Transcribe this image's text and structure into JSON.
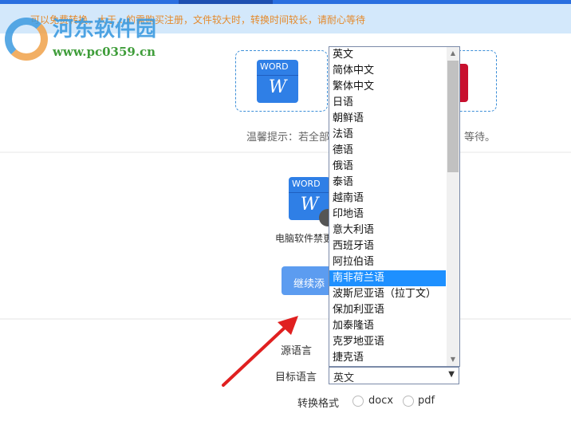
{
  "banner": {
    "text": "可以免费转换，大于…的需购买注册，文件较大时，转换时间较长，请耐心等待"
  },
  "watermark": {
    "title": "河东软件园",
    "url": "www.pc0359.cn"
  },
  "icons": {
    "word_label": "WORD",
    "word_letter": "W"
  },
  "hint": {
    "start": "温馨提示：若全部",
    "end": "等待。"
  },
  "file": {
    "name": "电脑软件禁更"
  },
  "buttons": {
    "add_more": "继续添"
  },
  "form": {
    "source_label": "源语言",
    "target_label": "目标语言",
    "target_value": "英文",
    "format_label": "转换格式",
    "formats": [
      "docx",
      "pdf"
    ]
  },
  "dropdown": {
    "items": [
      "英文",
      "简体中文",
      "繁体中文",
      "日语",
      "朝鲜语",
      "法语",
      "德语",
      "俄语",
      "泰语",
      "越南语",
      "印地语",
      "意大利语",
      "西班牙语",
      "阿拉伯语",
      "南非荷兰语",
      "波斯尼亚语（拉丁文）",
      "保加利亚语",
      "加泰隆语",
      "克罗地亚语",
      "捷克语"
    ],
    "highlighted": "南非荷兰语"
  },
  "colors": {
    "accent": "#2a6fe0",
    "highlight": "#1e90ff",
    "banner_text": "#e48a2c",
    "arrow": "#e02020"
  }
}
